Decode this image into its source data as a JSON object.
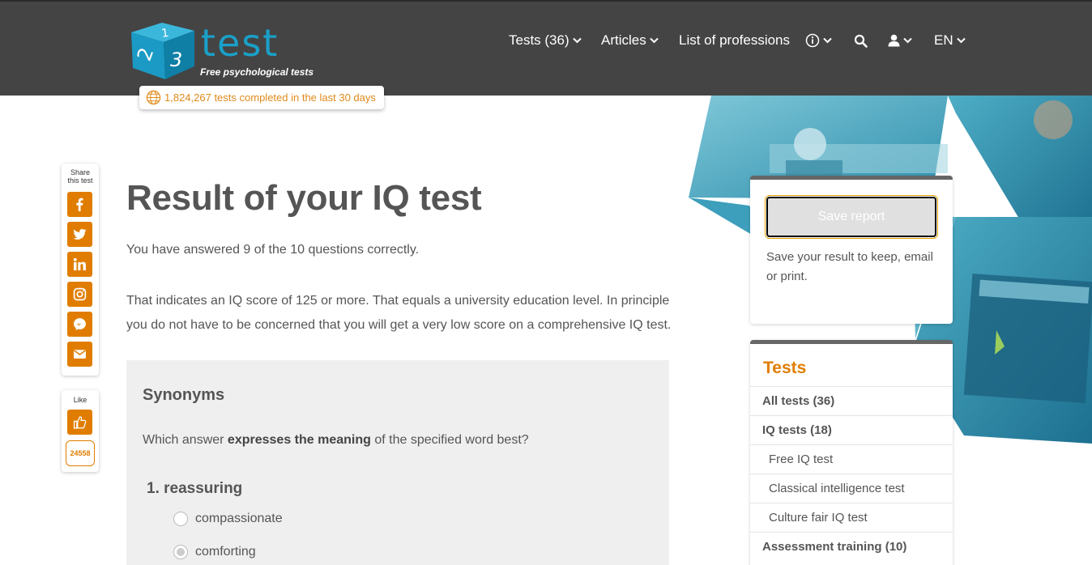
{
  "header": {
    "logo_text": "test",
    "logo_digits": [
      "1",
      "2",
      "3"
    ],
    "tagline": "Free psychological tests",
    "counter_text": "1,824,267 tests completed in the last 30 days",
    "nav": [
      {
        "label": "Tests (36)"
      },
      {
        "label": "Articles"
      },
      {
        "label": "List of professions"
      },
      {
        "label": ""
      },
      {
        "label": ""
      },
      {
        "label": ""
      },
      {
        "label": "EN"
      }
    ]
  },
  "share": {
    "title_line1": "Share",
    "title_line2": "this test",
    "buttons": [
      "facebook",
      "twitter",
      "linkedin",
      "instagram",
      "messenger",
      "email"
    ],
    "like_title": "Like",
    "like_count": "24558"
  },
  "main": {
    "title": "Result of your IQ test",
    "answered": "You have answered 9 of the 10 questions correctly.",
    "interpretation": "That indicates an IQ score of 125 or more. That equals a university education level. In principle you do not have to be concerned that you will get a very low score on a comprehensive IQ test.",
    "question_box": {
      "heading": "Synonyms",
      "prompt_before": "Which answer ",
      "prompt_bold": "expresses the meaning",
      "prompt_after": " of the specified word best?",
      "item": "1. reassuring",
      "options": [
        {
          "label": "compassionate",
          "selected": false
        },
        {
          "label": "comforting",
          "selected": true
        }
      ]
    }
  },
  "sidebar": {
    "save_button": "Save report",
    "save_note": "Save your result to keep, email or print.",
    "tests_title": "Tests",
    "tests_links": [
      {
        "label": "All tests (36)",
        "style": "bold"
      },
      {
        "label": "IQ tests (18)",
        "style": "bold"
      },
      {
        "label": "Free IQ test",
        "style": "sub"
      },
      {
        "label": "Classical intelligence test",
        "style": "sub"
      },
      {
        "label": "Culture fair IQ test",
        "style": "sub"
      },
      {
        "label": "Assessment training (10)",
        "style": "bold"
      }
    ]
  },
  "colors": {
    "header_bg": "#444444",
    "accent_orange": "#e07d00",
    "logo_blue": "#1aa0c8",
    "hero_teal": "#3aa6c0"
  }
}
